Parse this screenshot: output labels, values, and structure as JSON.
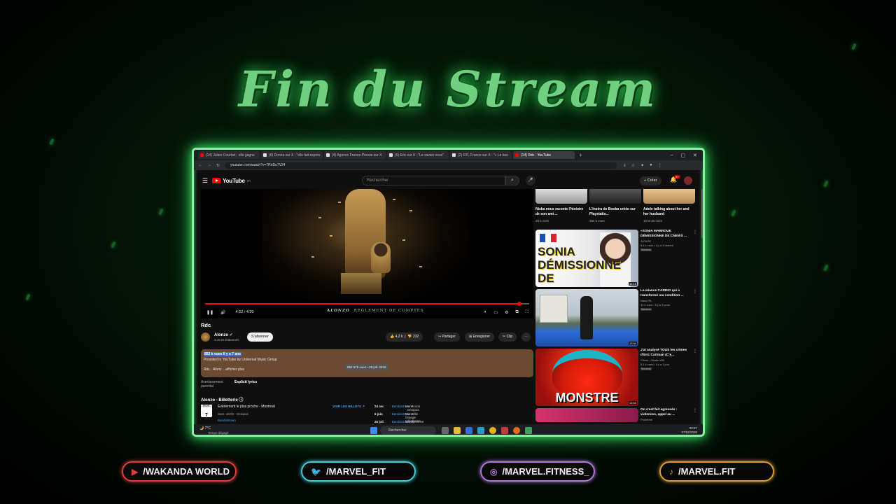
{
  "overlay": {
    "title": "Fin du Stream",
    "socials": [
      {
        "icon": "youtube-icon",
        "label": "/WAKANDA WORLD",
        "color": "#e03b3b"
      },
      {
        "icon": "twitter-icon",
        "label": "/MARVEL_FIT",
        "color": "#48c9d6"
      },
      {
        "icon": "instagram-icon",
        "label": "/MARVEL.FITNESS_",
        "color": "#b076d8"
      },
      {
        "icon": "tiktok-icon",
        "label": "/MARVEL.FIT",
        "color": "#d89a3a"
      }
    ]
  },
  "browser": {
    "tabs": [
      {
        "label": "(14) Julien Courbet : elle gagne",
        "active": false
      },
      {
        "label": "(6) Donna sur X : \"elle fait exprès",
        "active": false
      },
      {
        "label": "(4) Agence France-Presse sur X",
        "active": false
      },
      {
        "label": "(6) Eric sur X : \"Le saviez vous\"",
        "active": false
      },
      {
        "label": "(2) RTL France sur X : \"« Le bus",
        "active": false
      },
      {
        "label": "(14) Rdc - YouTube",
        "active": true
      }
    ],
    "new_tab": "+",
    "url": "youtube.com/watch?v=7RnDu7V24"
  },
  "youtube": {
    "logo": "YouTube",
    "logo_country": "FR",
    "search_placeholder": "Rechercher",
    "create_label": "Créer",
    "notif_count": "9+",
    "video": {
      "brand": "ALONZO",
      "album": "RÈGLEMENT DE COMPTES",
      "time": "4:22 / 4:30",
      "progress": 0.97
    },
    "title": "Rdc",
    "channel": {
      "name": "Alonzo",
      "subs": "3,15 M d'abonnés",
      "subscribe": "S'abonner"
    },
    "actions": {
      "likes": "4,2 k",
      "dislikes": "232",
      "share": "Partager",
      "save": "Enregistrer",
      "clip": "Clip"
    },
    "description": {
      "views": "852 k vues  Il y a 7 ans",
      "provided": "Provided to YouTube by Universal Music Group",
      "line": "Rdc · Alonz ...afficher plus",
      "tooltip": "852 675 vues • 29 juil. 2016"
    },
    "meta": {
      "key": "Avertissement parental",
      "value": "Explicit lyrics"
    },
    "tickets": {
      "title": "Alonzo - Billetterie",
      "event_month": "FÉVR.",
      "event_day": "7",
      "event_title": "Événement le plus proche - Montreal",
      "event_time": "Sam. 18:00 · Octopus",
      "event_seller": "Bandsintown",
      "voir": "VOIR LES BILLETS",
      "dates": [
        {
          "date": "24 avr.",
          "place": "Montcoron · Octopus",
          "seller": "Bandsintown"
        },
        {
          "date": "6 juin",
          "place": "Marseille · Orange Vélodrome",
          "seller": "Bandsintown"
        },
        {
          "date": "25 juil.",
          "place": "Carcassonne · Théâtre Jean Deschamps",
          "seller": "Bandsintown"
        }
      ]
    },
    "top_recs": [
      {
        "title": "Niska nous raconte l'histoire de son ami ...",
        "views": "20 k vues"
      },
      {
        "title": "L'Instru de Booba créée sur Playstatio...",
        "views": "384 k vues"
      },
      {
        "title": "Adele talking about her and her husband",
        "views": "10 M de vues"
      }
    ],
    "recs": [
      {
        "thumb_text": "SONIA DÉMISSIONNE DE CNEWS",
        "title": "«SONIA MABROUK DÉMISSIONNE DE CNEWS ...",
        "channel": "JLPAGE",
        "views": "5,4 k vues • il y a 4 heures",
        "badge": "Nouveau",
        "duration": "11:16"
      },
      {
        "thumb_text": "",
        "title": "La séance CARDIO qui a transformé ma condition ...",
        "channel": "Nass IRL",
        "views": "14 k vues • il y a 2 jours",
        "badge": "Nouveau",
        "duration": "13:54"
      },
      {
        "thumb_text": "MONSTRE",
        "title": "J'ai analysé TOUS les crimes d'Eric Cartman (C'e...",
        "channel": "Clover | Studio Will",
        "views": "5,1 k vues • il y a 1 jour",
        "badge": "Nouveau",
        "duration": "12:50"
      },
      {
        "thumb_text": "",
        "title": "On s'est fait agressés : violences, appel au ...",
        "channel": "Problème",
        "views": "",
        "badge": "",
        "duration": ""
      }
    ]
  },
  "taskbar": {
    "temp": "7°C",
    "weather": "Temps dégagé",
    "search": "Rechercher",
    "time": "00:37",
    "date": "07/02/2026"
  }
}
